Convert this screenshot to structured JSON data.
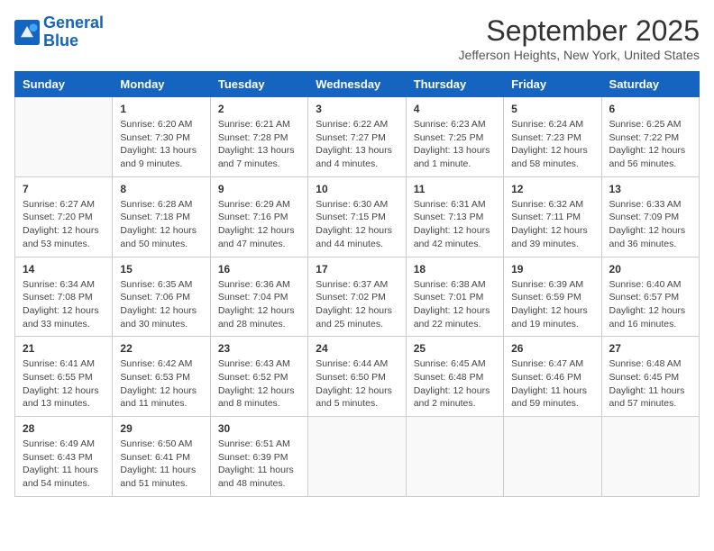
{
  "logo": {
    "line1": "General",
    "line2": "Blue"
  },
  "title": "September 2025",
  "location": "Jefferson Heights, New York, United States",
  "days_of_week": [
    "Sunday",
    "Monday",
    "Tuesday",
    "Wednesday",
    "Thursday",
    "Friday",
    "Saturday"
  ],
  "weeks": [
    [
      {
        "day": "",
        "detail": ""
      },
      {
        "day": "1",
        "detail": "Sunrise: 6:20 AM\nSunset: 7:30 PM\nDaylight: 13 hours\nand 9 minutes."
      },
      {
        "day": "2",
        "detail": "Sunrise: 6:21 AM\nSunset: 7:28 PM\nDaylight: 13 hours\nand 7 minutes."
      },
      {
        "day": "3",
        "detail": "Sunrise: 6:22 AM\nSunset: 7:27 PM\nDaylight: 13 hours\nand 4 minutes."
      },
      {
        "day": "4",
        "detail": "Sunrise: 6:23 AM\nSunset: 7:25 PM\nDaylight: 13 hours\nand 1 minute."
      },
      {
        "day": "5",
        "detail": "Sunrise: 6:24 AM\nSunset: 7:23 PM\nDaylight: 12 hours\nand 58 minutes."
      },
      {
        "day": "6",
        "detail": "Sunrise: 6:25 AM\nSunset: 7:22 PM\nDaylight: 12 hours\nand 56 minutes."
      }
    ],
    [
      {
        "day": "7",
        "detail": "Sunrise: 6:27 AM\nSunset: 7:20 PM\nDaylight: 12 hours\nand 53 minutes."
      },
      {
        "day": "8",
        "detail": "Sunrise: 6:28 AM\nSunset: 7:18 PM\nDaylight: 12 hours\nand 50 minutes."
      },
      {
        "day": "9",
        "detail": "Sunrise: 6:29 AM\nSunset: 7:16 PM\nDaylight: 12 hours\nand 47 minutes."
      },
      {
        "day": "10",
        "detail": "Sunrise: 6:30 AM\nSunset: 7:15 PM\nDaylight: 12 hours\nand 44 minutes."
      },
      {
        "day": "11",
        "detail": "Sunrise: 6:31 AM\nSunset: 7:13 PM\nDaylight: 12 hours\nand 42 minutes."
      },
      {
        "day": "12",
        "detail": "Sunrise: 6:32 AM\nSunset: 7:11 PM\nDaylight: 12 hours\nand 39 minutes."
      },
      {
        "day": "13",
        "detail": "Sunrise: 6:33 AM\nSunset: 7:09 PM\nDaylight: 12 hours\nand 36 minutes."
      }
    ],
    [
      {
        "day": "14",
        "detail": "Sunrise: 6:34 AM\nSunset: 7:08 PM\nDaylight: 12 hours\nand 33 minutes."
      },
      {
        "day": "15",
        "detail": "Sunrise: 6:35 AM\nSunset: 7:06 PM\nDaylight: 12 hours\nand 30 minutes."
      },
      {
        "day": "16",
        "detail": "Sunrise: 6:36 AM\nSunset: 7:04 PM\nDaylight: 12 hours\nand 28 minutes."
      },
      {
        "day": "17",
        "detail": "Sunrise: 6:37 AM\nSunset: 7:02 PM\nDaylight: 12 hours\nand 25 minutes."
      },
      {
        "day": "18",
        "detail": "Sunrise: 6:38 AM\nSunset: 7:01 PM\nDaylight: 12 hours\nand 22 minutes."
      },
      {
        "day": "19",
        "detail": "Sunrise: 6:39 AM\nSunset: 6:59 PM\nDaylight: 12 hours\nand 19 minutes."
      },
      {
        "day": "20",
        "detail": "Sunrise: 6:40 AM\nSunset: 6:57 PM\nDaylight: 12 hours\nand 16 minutes."
      }
    ],
    [
      {
        "day": "21",
        "detail": "Sunrise: 6:41 AM\nSunset: 6:55 PM\nDaylight: 12 hours\nand 13 minutes."
      },
      {
        "day": "22",
        "detail": "Sunrise: 6:42 AM\nSunset: 6:53 PM\nDaylight: 12 hours\nand 11 minutes."
      },
      {
        "day": "23",
        "detail": "Sunrise: 6:43 AM\nSunset: 6:52 PM\nDaylight: 12 hours\nand 8 minutes."
      },
      {
        "day": "24",
        "detail": "Sunrise: 6:44 AM\nSunset: 6:50 PM\nDaylight: 12 hours\nand 5 minutes."
      },
      {
        "day": "25",
        "detail": "Sunrise: 6:45 AM\nSunset: 6:48 PM\nDaylight: 12 hours\nand 2 minutes."
      },
      {
        "day": "26",
        "detail": "Sunrise: 6:47 AM\nSunset: 6:46 PM\nDaylight: 11 hours\nand 59 minutes."
      },
      {
        "day": "27",
        "detail": "Sunrise: 6:48 AM\nSunset: 6:45 PM\nDaylight: 11 hours\nand 57 minutes."
      }
    ],
    [
      {
        "day": "28",
        "detail": "Sunrise: 6:49 AM\nSunset: 6:43 PM\nDaylight: 11 hours\nand 54 minutes."
      },
      {
        "day": "29",
        "detail": "Sunrise: 6:50 AM\nSunset: 6:41 PM\nDaylight: 11 hours\nand 51 minutes."
      },
      {
        "day": "30",
        "detail": "Sunrise: 6:51 AM\nSunset: 6:39 PM\nDaylight: 11 hours\nand 48 minutes."
      },
      {
        "day": "",
        "detail": ""
      },
      {
        "day": "",
        "detail": ""
      },
      {
        "day": "",
        "detail": ""
      },
      {
        "day": "",
        "detail": ""
      }
    ]
  ]
}
